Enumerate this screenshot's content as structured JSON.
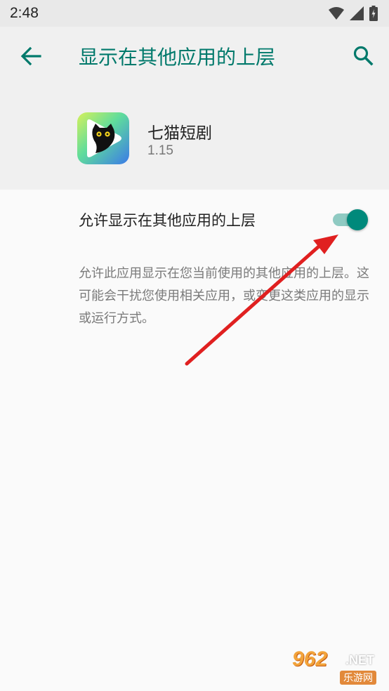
{
  "status_bar": {
    "time": "2:48",
    "icons": [
      "wifi-icon",
      "cell-signal-icon",
      "battery-icon"
    ]
  },
  "app_bar": {
    "title": "显示在其他应用的上层",
    "back_icon": "arrow-left-icon",
    "search_icon": "search-icon"
  },
  "app_header": {
    "name": "七猫短剧",
    "version": "1.15"
  },
  "setting": {
    "label": "允许显示在其他应用的上层",
    "enabled": true,
    "description": "允许此应用显示在您当前使用的其他应用的上层。这可能会干扰您使用相关应用，或变更这类应用的显示或运行方式。"
  },
  "colors": {
    "accent": "#00796b",
    "toggle_thumb": "#00897b",
    "toggle_track": "#8fcac2",
    "annotation_arrow": "#e02020"
  },
  "watermark": {
    "brand": "962",
    "suffix": ".NET",
    "subtitle": "乐游网"
  }
}
